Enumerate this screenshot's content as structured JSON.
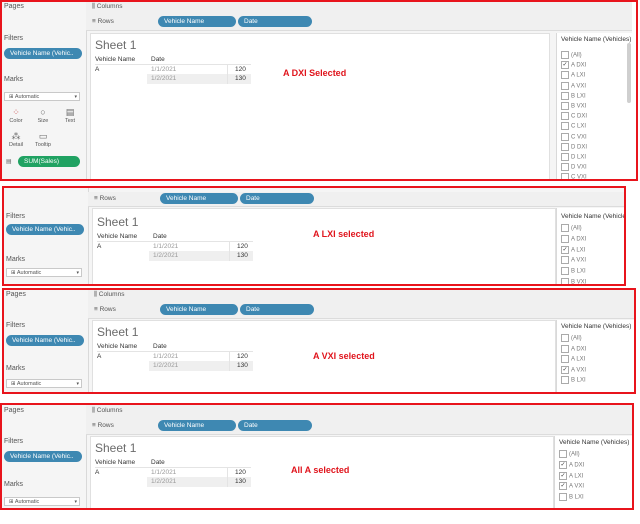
{
  "labels": {
    "pages": "Pages",
    "columns": "Columns",
    "rows": "Rows",
    "filters": "Filters",
    "marks": "Marks",
    "filter_pill": "Vehicle Name (Vehic..",
    "rows_pill_1": "Vehicle Name",
    "rows_pill_2": "Date",
    "sheet_title": "Sheet 1",
    "col_vehicle": "Vehicle Name",
    "col_date": "Date",
    "card_title": "Vehicle Name (Vehicles)",
    "marks_type": "Automatic",
    "marks_color": "Color",
    "marks_size": "Size",
    "marks_text": "Text",
    "marks_detail": "Detail",
    "marks_tooltip": "Tooltip",
    "sales_pill": "SUM(Sales)"
  },
  "table": {
    "vehicle": "A",
    "row1_date": "1/1/2021",
    "row1_value": "120",
    "row2_date": "1/2/2021",
    "row2_value": "130"
  },
  "panels": [
    {
      "annotation": "A DXI Selected",
      "items": [
        {
          "label": "(All)",
          "checked": false
        },
        {
          "label": "A DXI",
          "checked": true
        },
        {
          "label": "A LXI",
          "checked": false
        },
        {
          "label": "A VXI",
          "checked": false
        },
        {
          "label": "B LXI",
          "checked": false
        },
        {
          "label": "B VXI",
          "checked": false
        },
        {
          "label": "C DXI",
          "checked": false
        },
        {
          "label": "C LXI",
          "checked": false
        },
        {
          "label": "C VXI",
          "checked": false
        },
        {
          "label": "D DXI",
          "checked": false
        },
        {
          "label": "D LXI",
          "checked": false
        },
        {
          "label": "D VXI",
          "checked": false
        },
        {
          "label": "C VXI",
          "checked": false
        }
      ]
    },
    {
      "annotation": "A LXI selected",
      "items": [
        {
          "label": "(All)",
          "checked": false
        },
        {
          "label": "A DXI",
          "checked": false
        },
        {
          "label": "A LXI",
          "checked": true
        },
        {
          "label": "A VXI",
          "checked": false
        },
        {
          "label": "B LXI",
          "checked": false
        },
        {
          "label": "B VXI",
          "checked": false
        }
      ]
    },
    {
      "annotation": "A VXI selected",
      "items": [
        {
          "label": "(All)",
          "checked": false
        },
        {
          "label": "A DXI",
          "checked": false
        },
        {
          "label": "A LXI",
          "checked": false
        },
        {
          "label": "A VXI",
          "checked": true
        },
        {
          "label": "B LXI",
          "checked": false
        }
      ]
    },
    {
      "annotation": "All A selected",
      "items": [
        {
          "label": "(All)",
          "checked": false
        },
        {
          "label": "A DXI",
          "checked": true
        },
        {
          "label": "A LXI",
          "checked": true
        },
        {
          "label": "A VXI",
          "checked": true
        },
        {
          "label": "B LXI",
          "checked": false
        }
      ]
    }
  ]
}
